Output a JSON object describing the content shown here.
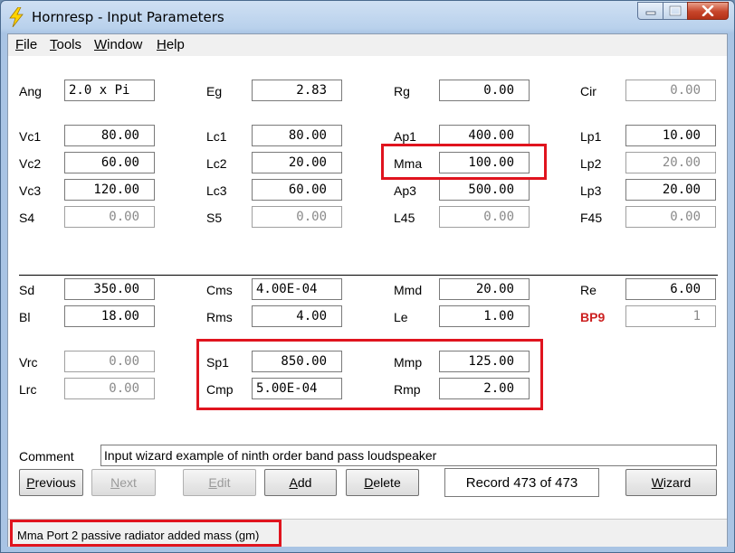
{
  "window": {
    "title": "Hornresp - Input Parameters",
    "close_glyph": "✕",
    "min_glyph": "▁",
    "max_glyph": "▭"
  },
  "menu": [
    {
      "u": "F",
      "rest": "ile"
    },
    {
      "u": "T",
      "rest": "ools"
    },
    {
      "u": "W",
      "rest": "indow"
    },
    {
      "u": "H",
      "rest": "elp"
    }
  ],
  "params": {
    "ang": {
      "label": "Ang",
      "value": "2.0 x Pi"
    },
    "eg": {
      "label": "Eg",
      "value": "2.83"
    },
    "rg": {
      "label": "Rg",
      "value": "0.00"
    },
    "cir": {
      "label": "Cir",
      "value": "0.00"
    },
    "vc1": {
      "label": "Vc1",
      "value": "80.00"
    },
    "lc1": {
      "label": "Lc1",
      "value": "80.00"
    },
    "ap1": {
      "label": "Ap1",
      "value": "400.00"
    },
    "lp1": {
      "label": "Lp1",
      "value": "10.00"
    },
    "vc2": {
      "label": "Vc2",
      "value": "60.00"
    },
    "lc2": {
      "label": "Lc2",
      "value": "20.00"
    },
    "mma": {
      "label": "Mma",
      "value": "100.00"
    },
    "lp2": {
      "label": "Lp2",
      "value": "20.00"
    },
    "vc3": {
      "label": "Vc3",
      "value": "120.00"
    },
    "lc3": {
      "label": "Lc3",
      "value": "60.00"
    },
    "ap3": {
      "label": "Ap3",
      "value": "500.00"
    },
    "lp3": {
      "label": "Lp3",
      "value": "20.00"
    },
    "s4": {
      "label": "S4",
      "value": "0.00"
    },
    "s5": {
      "label": "S5",
      "value": "0.00"
    },
    "l45": {
      "label": "L45",
      "value": "0.00"
    },
    "f45": {
      "label": "F45",
      "value": "0.00"
    },
    "sd": {
      "label": "Sd",
      "value": "350.00"
    },
    "cms": {
      "label": "Cms",
      "value": "4.00E-04"
    },
    "mmd": {
      "label": "Mmd",
      "value": "20.00"
    },
    "re": {
      "label": "Re",
      "value": "6.00"
    },
    "bl": {
      "label": "Bl",
      "value": "18.00"
    },
    "rms": {
      "label": "Rms",
      "value": "4.00"
    },
    "le": {
      "label": "Le",
      "value": "1.00"
    },
    "bp9": {
      "label": "BP9",
      "value": "1"
    },
    "vrc": {
      "label": "Vrc",
      "value": "0.00"
    },
    "sp1": {
      "label": "Sp1",
      "value": "850.00"
    },
    "mmp": {
      "label": "Mmp",
      "value": "125.00"
    },
    "lrc": {
      "label": "Lrc",
      "value": "0.00"
    },
    "cmp": {
      "label": "Cmp",
      "value": "5.00E-04"
    },
    "rmp": {
      "label": "Rmp",
      "value": "2.00"
    }
  },
  "comment": {
    "label": "Comment",
    "value": "Input wizard example of ninth order band pass loudspeaker"
  },
  "buttons": {
    "previous": {
      "u": "P",
      "rest": "revious"
    },
    "next": {
      "u": "N",
      "rest": "ext"
    },
    "edit": {
      "u": "E",
      "rest": "dit"
    },
    "add": {
      "u": "A",
      "rest": "dd"
    },
    "delete": {
      "u": "D",
      "rest": "elete"
    },
    "wizard": {
      "u": "W",
      "rest": "izard"
    }
  },
  "record": "Record 473 of 473",
  "status": "Mma  Port 2 passive radiator added mass  (gm)",
  "colors": {
    "highlight": "#e0141e",
    "bp9_label": "#cc2020"
  }
}
